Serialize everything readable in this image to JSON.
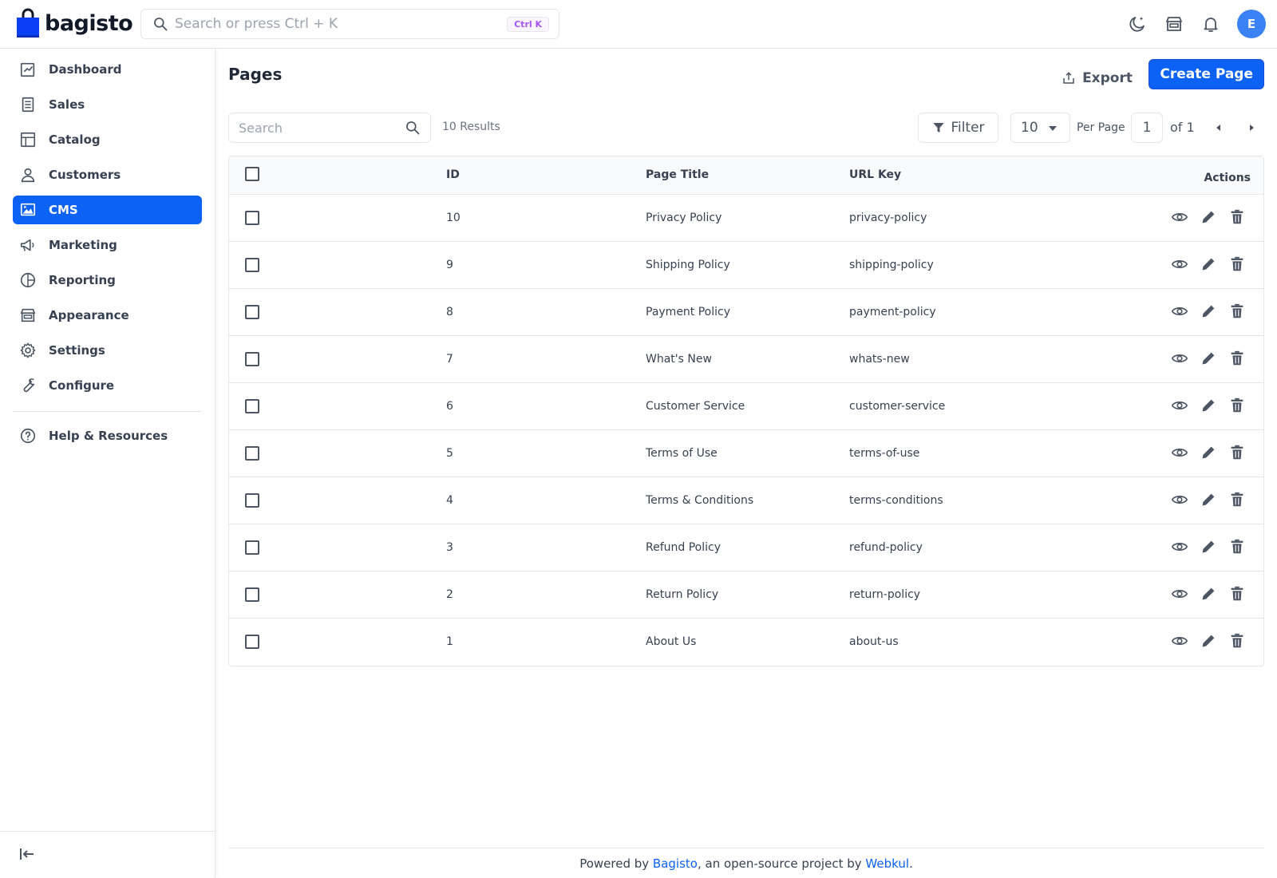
{
  "app": {
    "brand": "bagisto",
    "colors": {
      "accent": "#0b62f5",
      "avatar": "#3b82f6",
      "kbd": "#a855f7"
    }
  },
  "header": {
    "search_placeholder": "Search or press Ctrl + K",
    "search_shortcut": "Ctrl K",
    "avatar_initial": "E",
    "icons": [
      "dark-mode-icon",
      "storefront-icon",
      "notification-icon"
    ]
  },
  "sidebar": {
    "items": [
      {
        "label": "Dashboard",
        "icon": "dashboard-icon"
      },
      {
        "label": "Sales",
        "icon": "sales-icon"
      },
      {
        "label": "Catalog",
        "icon": "catalog-icon"
      },
      {
        "label": "Customers",
        "icon": "customers-icon"
      },
      {
        "label": "CMS",
        "icon": "cms-icon",
        "active": true
      },
      {
        "label": "Marketing",
        "icon": "marketing-icon"
      },
      {
        "label": "Reporting",
        "icon": "reporting-icon"
      },
      {
        "label": "Appearance",
        "icon": "appearance-icon"
      },
      {
        "label": "Settings",
        "icon": "settings-icon"
      },
      {
        "label": "Configure",
        "icon": "configure-icon"
      }
    ],
    "help": {
      "label": "Help & Resources",
      "icon": "help-icon"
    }
  },
  "main": {
    "title": "Pages",
    "export_label": "Export",
    "create_label": "Create Page",
    "toolbar": {
      "search_placeholder": "Search",
      "results": "10 Results",
      "filter_label": "Filter",
      "per_page_value": "10",
      "per_page_label": "Per Page",
      "page_value": "1",
      "of_label": "of 1"
    },
    "table": {
      "columns": [
        "ID",
        "Page Title",
        "URL Key",
        "Actions"
      ],
      "rows": [
        {
          "id": "10",
          "title": "Privacy Policy",
          "url": "privacy-policy"
        },
        {
          "id": "9",
          "title": "Shipping Policy",
          "url": "shipping-policy"
        },
        {
          "id": "8",
          "title": "Payment Policy",
          "url": "payment-policy"
        },
        {
          "id": "7",
          "title": "What's New",
          "url": "whats-new"
        },
        {
          "id": "6",
          "title": "Customer Service",
          "url": "customer-service"
        },
        {
          "id": "5",
          "title": "Terms of Use",
          "url": "terms-of-use"
        },
        {
          "id": "4",
          "title": "Terms & Conditions",
          "url": "terms-conditions"
        },
        {
          "id": "3",
          "title": "Refund Policy",
          "url": "refund-policy"
        },
        {
          "id": "2",
          "title": "Return Policy",
          "url": "return-policy"
        },
        {
          "id": "1",
          "title": "About Us",
          "url": "about-us"
        }
      ]
    }
  },
  "footer": {
    "prefix": "Powered by ",
    "link1": "Bagisto",
    "middle": ", an open-source project by ",
    "link2": "Webkul",
    "suffix": "."
  }
}
